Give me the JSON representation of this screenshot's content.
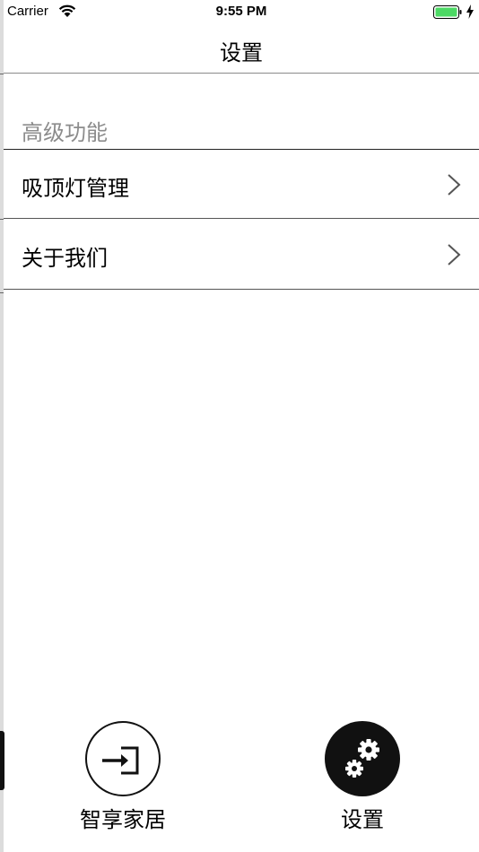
{
  "status_bar": {
    "carrier": "Carrier",
    "time": "9:55 PM",
    "battery_color": "#4cd964"
  },
  "nav": {
    "title": "设置"
  },
  "sections": [
    {
      "header": "高级功能",
      "items": [
        {
          "label": "吸顶灯管理",
          "icon": "chevron-right-icon"
        },
        {
          "label": "关于我们",
          "icon": "chevron-right-icon"
        }
      ]
    }
  ],
  "tab_bar": {
    "items": [
      {
        "label": "智享家居",
        "icon": "login-arrow-icon",
        "selected": false
      },
      {
        "label": "设置",
        "icon": "gears-icon",
        "selected": true
      }
    ]
  }
}
